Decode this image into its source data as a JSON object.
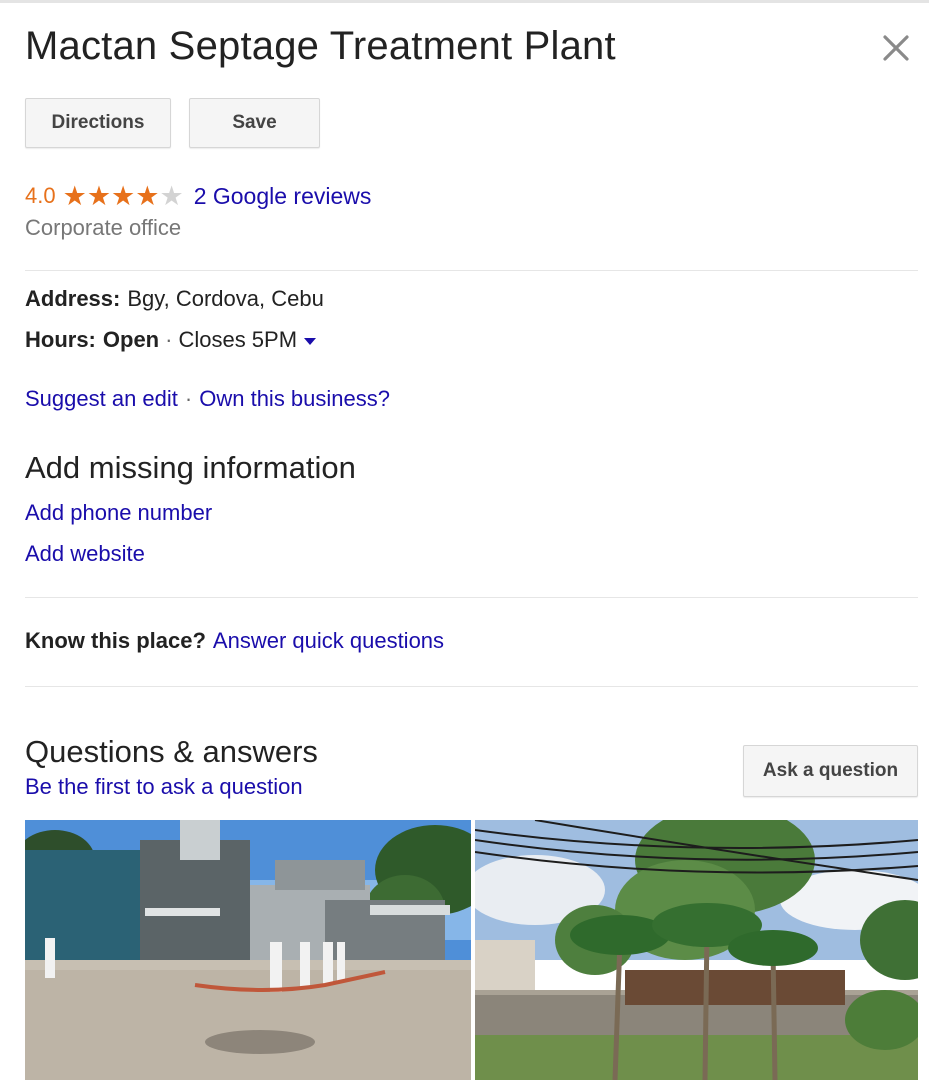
{
  "panel": {
    "title": "Mactan Septage Treatment Plant",
    "buttons": {
      "directions": "Directions",
      "save": "Save"
    },
    "rating": {
      "value": "4.0",
      "stars_filled": 4,
      "stars_total": 5,
      "reviews_label": "2 Google reviews"
    },
    "category": "Corporate office",
    "address": {
      "label": "Address:",
      "value": "Bgy, Cordova, Cebu"
    },
    "hours": {
      "label": "Hours:",
      "status": "Open",
      "separator": "·",
      "detail": "Closes 5PM"
    },
    "edit_links": {
      "suggest": "Suggest an edit",
      "separator": "·",
      "own": "Own this business?"
    },
    "missing_info": {
      "title": "Add missing information",
      "add_phone": "Add phone number",
      "add_website": "Add website"
    },
    "know_place": {
      "label": "Know this place?",
      "link": "Answer quick questions"
    },
    "qa": {
      "title": "Questions & answers",
      "subtitle": "Be the first to ask a question",
      "ask_button": "Ask a question"
    },
    "icons": {
      "close": "close-icon",
      "star_full": "star-full-icon",
      "star_empty": "star-empty-icon",
      "caret": "caret-down-icon"
    },
    "colors": {
      "link": "#1a0dab",
      "rating": "#e7711b",
      "star_empty": "#d3d3d3",
      "button_bg": "#f5f5f5"
    }
  }
}
